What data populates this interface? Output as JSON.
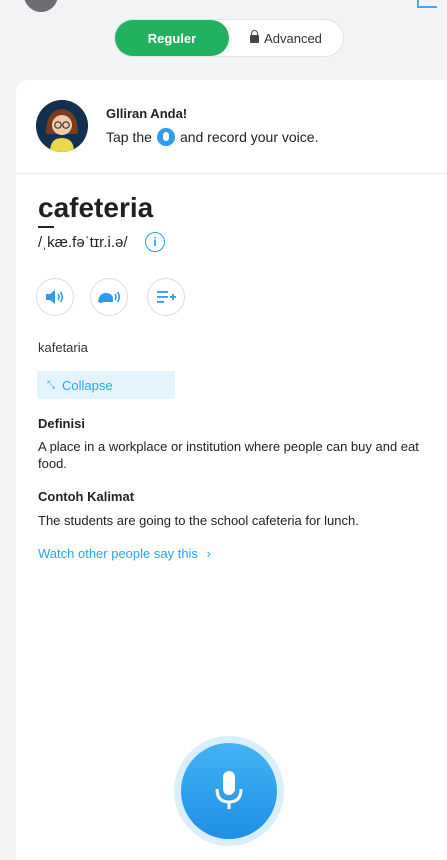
{
  "mode_toggle": {
    "regular_label": "Reguler",
    "advanced_label": "Advanced"
  },
  "coach": {
    "title": "Glliran Anda!",
    "text_before": "Tap the",
    "text_after": "and record your voice."
  },
  "word": {
    "text": "cafeteria",
    "ipa": "/ˌkæ.fəˈtɪr.i.ə/",
    "meaning": "kafetaria"
  },
  "collapse_label": "Collapse",
  "definition": {
    "label": "Definisi",
    "text": "A place in a workplace or institution where people can buy and eat food."
  },
  "example": {
    "label": "Contoh Kalimat",
    "text": "The students are going to the school cafeteria for lunch."
  },
  "watch_link": "Watch other people say this",
  "colors": {
    "accent_green": "#20b25f",
    "accent_blue": "#2d9cf0"
  },
  "icons": [
    "lock-icon",
    "microphone-icon",
    "speaker-icon",
    "slow-speaker-icon",
    "add-to-list-icon",
    "info-icon",
    "collapse-icon",
    "chevron-right-icon"
  ]
}
